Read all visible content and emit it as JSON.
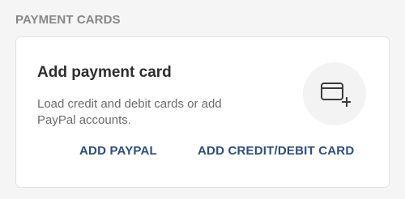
{
  "section": {
    "header": "PAYMENT CARDS"
  },
  "card": {
    "title": "Add payment card",
    "description": "Load credit and debit cards or add PayPal accounts.",
    "icon": "add-card-icon",
    "actions": {
      "paypal_label": "ADD PAYPAL",
      "credit_label": "ADD CREDIT/DEBIT CARD"
    }
  },
  "colors": {
    "background": "#f5f5f5",
    "card": "#ffffff",
    "header_text": "#878787",
    "title_text": "#2e2e2e",
    "body_text": "#6b6b6b",
    "action_text": "#2d4e7e",
    "icon_bg": "#f3f3f3"
  }
}
